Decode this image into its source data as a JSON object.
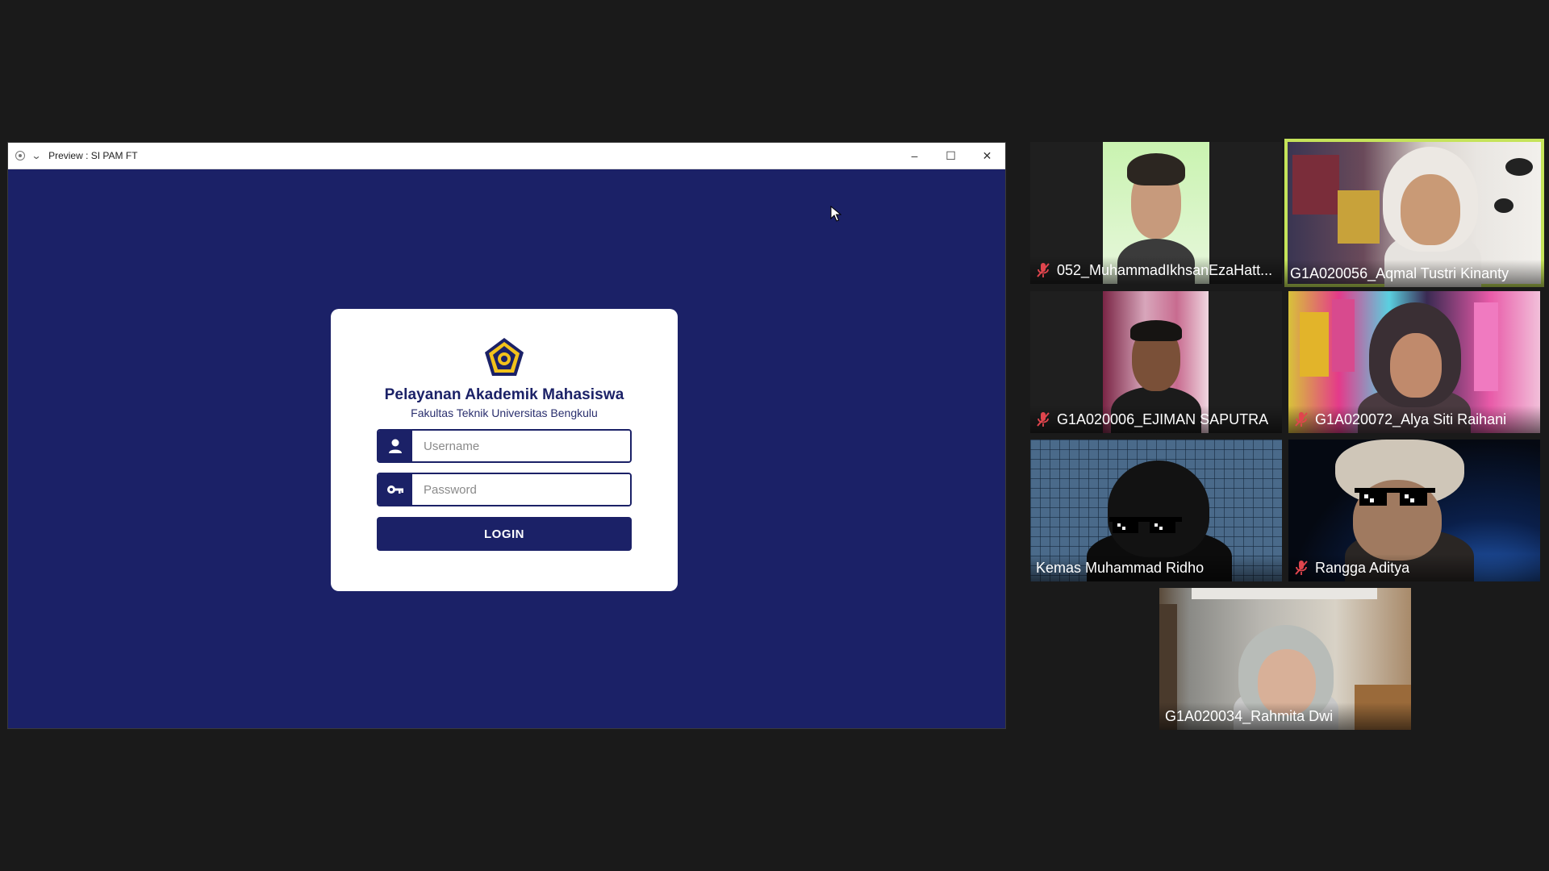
{
  "shared_window": {
    "title": "Preview : SI PAM FT",
    "controls": {
      "minimize": "–",
      "maximize": "☐",
      "close": "✕"
    }
  },
  "login": {
    "title": "Pelayanan Akademik Mahasiswa",
    "subtitle": "Fakultas Teknik Universitas Bengkulu",
    "username_placeholder": "Username",
    "password_placeholder": "Password",
    "button_label": "LOGIN"
  },
  "participants": [
    {
      "name": "052_MuhammadIkhsanEzaHatt...",
      "muted": true
    },
    {
      "name": "G1A020056_Aqmal Tustri Kinanty",
      "muted": false,
      "active_speaker": true
    },
    {
      "name": "G1A020006_EJIMAN SAPUTRA",
      "muted": true
    },
    {
      "name": "G1A020072_Alya Siti Raihani",
      "muted": true
    },
    {
      "name": "Kemas Muhammad Ridho",
      "muted": false
    },
    {
      "name": "Rangga Aditya",
      "muted": true
    },
    {
      "name": "G1A020034_Rahmita Dwi",
      "muted": false
    }
  ],
  "colors": {
    "app_background": "#1a1a1a",
    "login_background": "#1b2167",
    "active_speaker_border": "#c5e35a",
    "muted_icon": "#e0454d"
  }
}
